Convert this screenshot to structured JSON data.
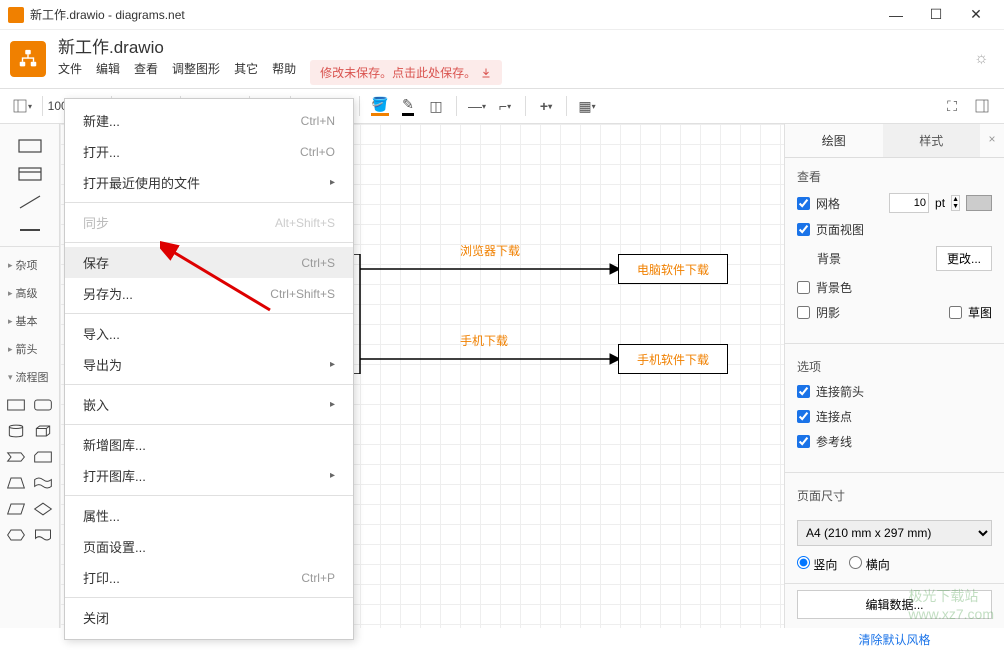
{
  "window": {
    "title": "新工作.drawio - diagrams.net"
  },
  "header": {
    "filename": "新工作.drawio",
    "menus": [
      "文件",
      "编辑",
      "查看",
      "调整图形",
      "其它",
      "帮助"
    ],
    "unsaved": "修改未保存。点击此处保存。"
  },
  "toolbar": {
    "zoom": "100%"
  },
  "shapes": {
    "categories": [
      "杂项",
      "高级",
      "基本",
      "箭头",
      "流程图"
    ]
  },
  "file_menu": {
    "new": {
      "label": "新建...",
      "shortcut": "Ctrl+N"
    },
    "open": {
      "label": "打开...",
      "shortcut": "Ctrl+O"
    },
    "recent": {
      "label": "打开最近使用的文件"
    },
    "sync": {
      "label": "同步",
      "shortcut": "Alt+Shift+S"
    },
    "save": {
      "label": "保存",
      "shortcut": "Ctrl+S"
    },
    "saveas": {
      "label": "另存为...",
      "shortcut": "Ctrl+Shift+S"
    },
    "import": {
      "label": "导入..."
    },
    "export": {
      "label": "导出为"
    },
    "embed": {
      "label": "嵌入"
    },
    "newlib": {
      "label": "新增图库..."
    },
    "openlib": {
      "label": "打开图库..."
    },
    "props": {
      "label": "属性..."
    },
    "pagesetup": {
      "label": "页面设置..."
    },
    "print": {
      "label": "打印...",
      "shortcut": "Ctrl+P"
    },
    "close": {
      "label": "关闭"
    }
  },
  "canvas": {
    "label1": "浏览器下载",
    "box1": "电脑软件下载",
    "label2": "手机下载",
    "box2": "手机软件下载"
  },
  "right_panel": {
    "tab1": "绘图",
    "tab2": "样式",
    "view_title": "查看",
    "grid": "网格",
    "grid_size": "10",
    "grid_unit": "pt",
    "page_view": "页面视图",
    "background": "背景",
    "change": "更改...",
    "bgcolor": "背景色",
    "shadow": "阴影",
    "sketch": "草图",
    "options_title": "选项",
    "arrow": "连接箭头",
    "points": "连接点",
    "guides": "参考线",
    "page_size_title": "页面尺寸",
    "page_size": "A4 (210 mm x 297 mm)",
    "portrait": "竖向",
    "landscape": "横向",
    "edit_data": "编辑数据...",
    "reset_style": "清除默认风格"
  },
  "watermark": "极光下载站\nwww.xz7.com"
}
